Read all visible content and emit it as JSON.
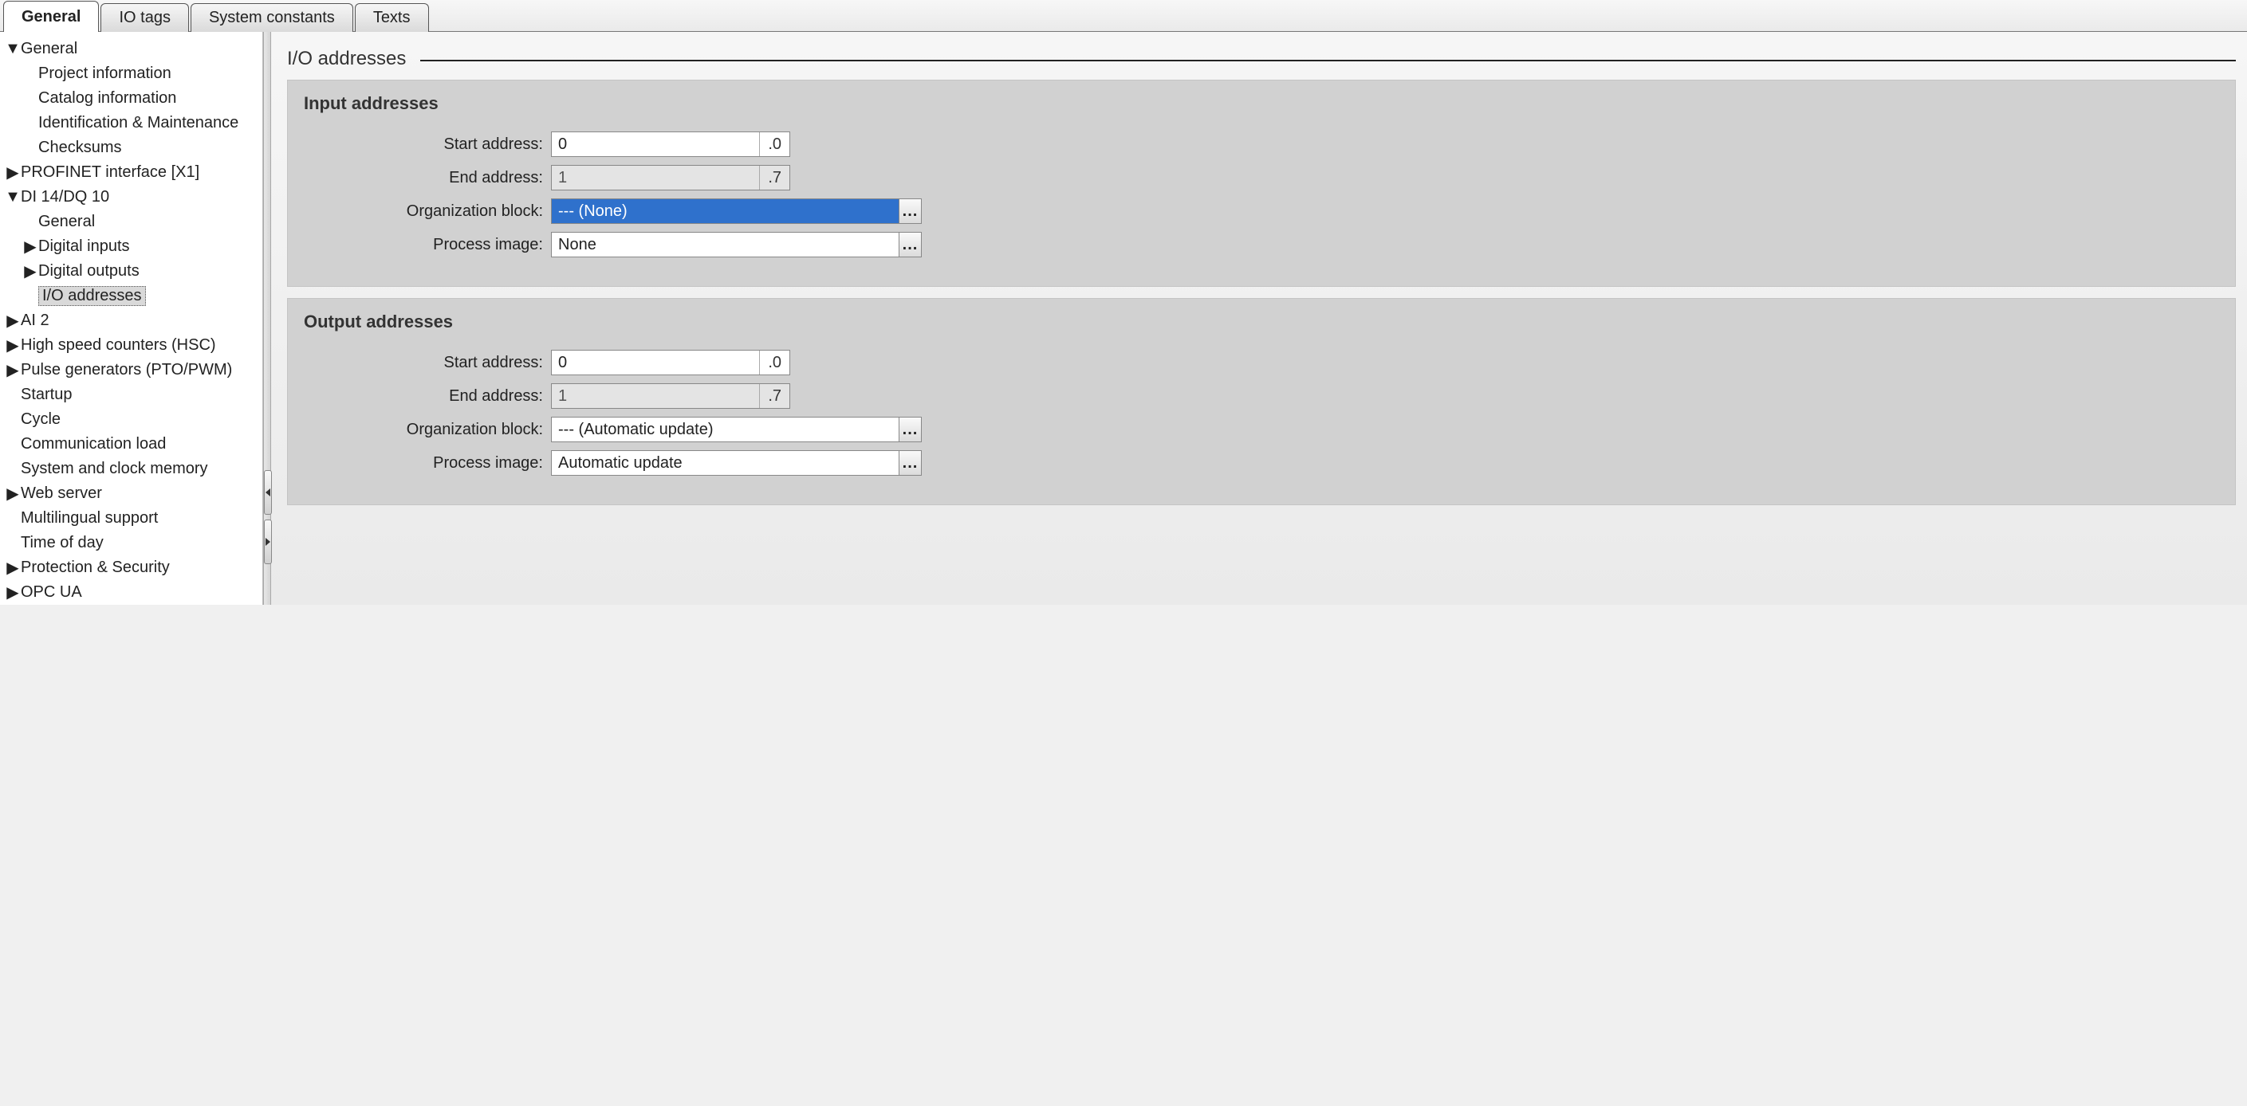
{
  "tabs": {
    "general": "General",
    "io_tags": "IO tags",
    "system_constants": "System constants",
    "texts": "Texts"
  },
  "tree": {
    "general": "General",
    "project_information": "Project information",
    "catalog_information": "Catalog information",
    "identification_maintenance": "Identification & Maintenance",
    "checksums": "Checksums",
    "profinet_interface": "PROFINET interface [X1]",
    "di14dq10": "DI 14/DQ 10",
    "di_general": "General",
    "digital_inputs": "Digital inputs",
    "digital_outputs": "Digital outputs",
    "io_addresses": "I/O addresses",
    "ai2": "AI 2",
    "hsc": "High speed counters (HSC)",
    "pto_pwm": "Pulse generators (PTO/PWM)",
    "startup": "Startup",
    "cycle": "Cycle",
    "communication_load": "Communication load",
    "system_clock_memory": "System and clock memory",
    "web_server": "Web server",
    "multilingual_support": "Multilingual support",
    "time_of_day": "Time of day",
    "protection_security": "Protection & Security",
    "opc_ua": "OPC UA"
  },
  "content": {
    "section_title": "I/O addresses",
    "input_addresses": {
      "title": "Input addresses",
      "start_label": "Start address:",
      "start_value": "0",
      "start_suffix": ".0",
      "end_label": "End address:",
      "end_value": "1",
      "end_suffix": ".7",
      "org_block_label": "Organization block:",
      "org_block_value": "--- (None)",
      "process_image_label": "Process image:",
      "process_image_value": "None"
    },
    "output_addresses": {
      "title": "Output addresses",
      "start_label": "Start address:",
      "start_value": "0",
      "start_suffix": ".0",
      "end_label": "End address:",
      "end_value": "1",
      "end_suffix": ".7",
      "org_block_label": "Organization block:",
      "org_block_value": "--- (Automatic update)",
      "process_image_label": "Process image:",
      "process_image_value": "Automatic update"
    },
    "ellipsis": "..."
  }
}
